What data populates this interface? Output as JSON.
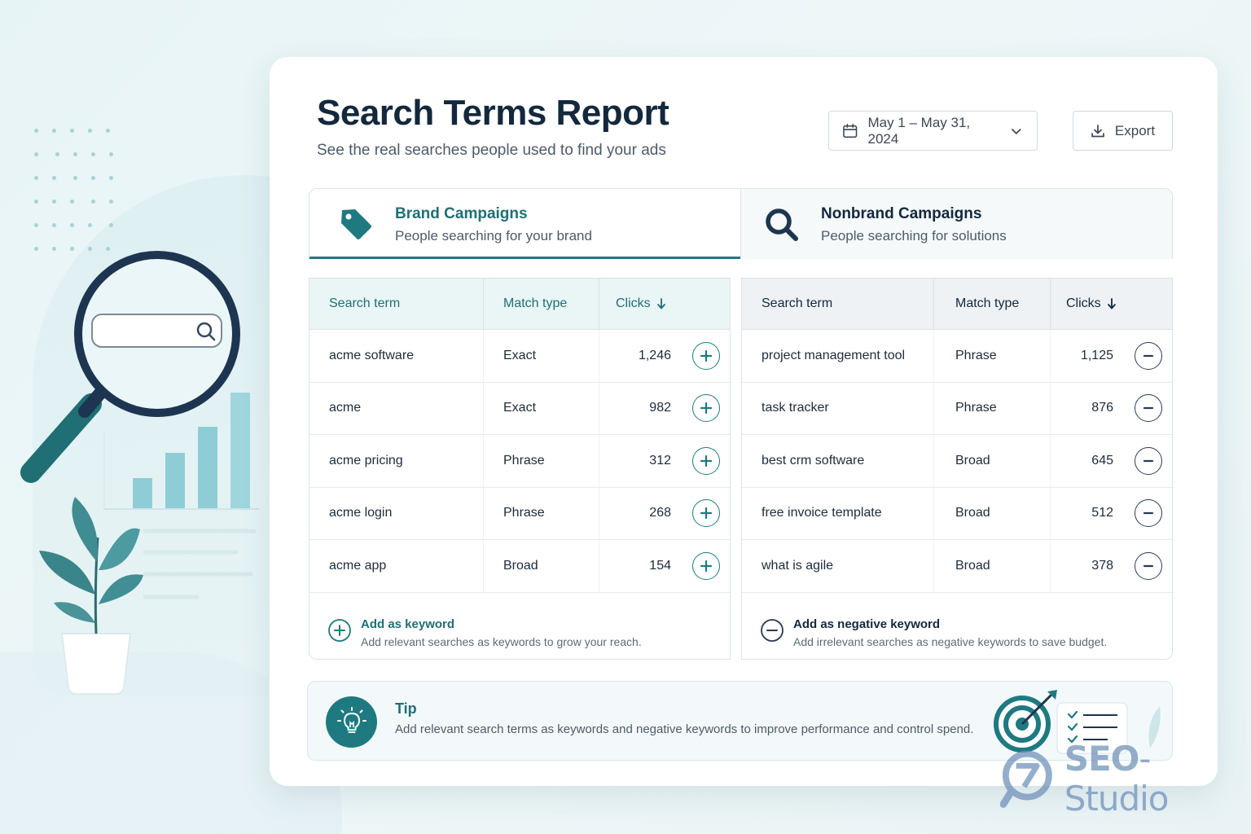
{
  "header": {
    "title": "Search Terms Report",
    "subtitle": "See the real searches people used to find your ads",
    "date_range": "May 1 – May 31, 2024",
    "export_label": "Export"
  },
  "tabs": [
    {
      "title": "Brand Campaigns",
      "subtitle": "People searching for your brand",
      "icon": "tag-icon",
      "active": true
    },
    {
      "title": "Nonbrand Campaigns",
      "subtitle": "People searching for solutions",
      "icon": "search-icon",
      "active": false
    }
  ],
  "brand_table": {
    "columns": [
      "Search term",
      "Match type",
      "Clicks"
    ],
    "rows": [
      {
        "term": "acme software",
        "match": "Exact",
        "clicks": "1,246"
      },
      {
        "term": "acme",
        "match": "Exact",
        "clicks": "982"
      },
      {
        "term": "acme pricing",
        "match": "Phrase",
        "clicks": "312"
      },
      {
        "term": "acme login",
        "match": "Phrase",
        "clicks": "268"
      },
      {
        "term": "acme app",
        "match": "Broad",
        "clicks": "154"
      }
    ],
    "row_action_icon": "plus-circle-icon",
    "footer_title": "Add as keyword",
    "footer_desc": "Add relevant searches as keywords to grow your reach."
  },
  "nonbrand_table": {
    "columns": [
      "Search term",
      "Match type",
      "Clicks"
    ],
    "rows": [
      {
        "term": "project management tool",
        "match": "Phrase",
        "clicks": "1,125"
      },
      {
        "term": "task tracker",
        "match": "Phrase",
        "clicks": "876"
      },
      {
        "term": "best crm software",
        "match": "Broad",
        "clicks": "645"
      },
      {
        "term": "free invoice template",
        "match": "Broad",
        "clicks": "512"
      },
      {
        "term": "what is agile",
        "match": "Broad",
        "clicks": "378"
      }
    ],
    "row_action_icon": "minus-circle-icon",
    "footer_title": "Add as negative keyword",
    "footer_desc": "Add irrelevant searches as negative keywords to save budget."
  },
  "tip": {
    "title": "Tip",
    "text": "Add relevant search terms as keywords and negative keywords to improve performance and control spend.",
    "icon": "lightbulb-icon"
  },
  "watermark": {
    "bold": "SEO",
    "rest": "-Studio"
  },
  "colors": {
    "accent": "#1e7a80",
    "navy": "#13283d",
    "negative": "#2a3a55"
  }
}
